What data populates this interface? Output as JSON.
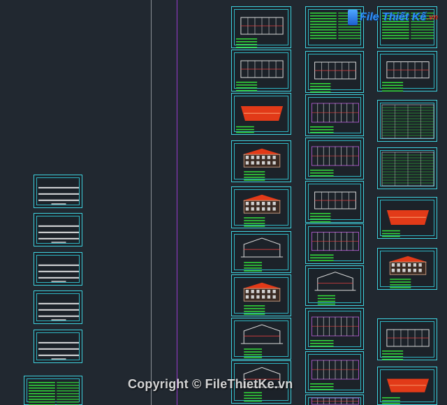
{
  "viewport": {
    "background": "#212830",
    "sheet_border_color": "#3fd3e0"
  },
  "watermark": {
    "logo_main": "File Thiết Kế",
    "logo_suffix": ".vn",
    "copyright": "Copyright © FileThietKe.vn"
  },
  "colors": {
    "line_gray": "#8a8f95",
    "line_purple": "#9b3bd1",
    "roof_red": "#e23a18",
    "annotation_green": "#33e03a",
    "wall_white": "#d9d9d9"
  }
}
